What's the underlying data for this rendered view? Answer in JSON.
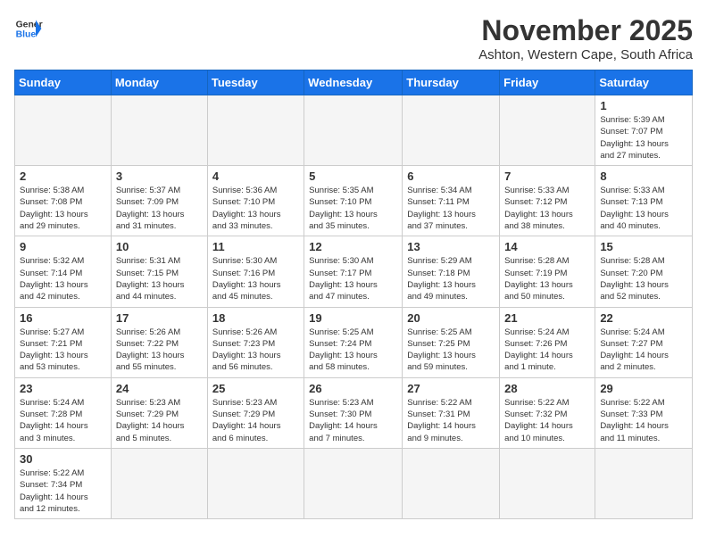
{
  "header": {
    "logo_general": "General",
    "logo_blue": "Blue",
    "month_year": "November 2025",
    "location": "Ashton, Western Cape, South Africa"
  },
  "weekdays": [
    "Sunday",
    "Monday",
    "Tuesday",
    "Wednesday",
    "Thursday",
    "Friday",
    "Saturday"
  ],
  "weeks": [
    [
      {
        "day": "",
        "info": ""
      },
      {
        "day": "",
        "info": ""
      },
      {
        "day": "",
        "info": ""
      },
      {
        "day": "",
        "info": ""
      },
      {
        "day": "",
        "info": ""
      },
      {
        "day": "",
        "info": ""
      },
      {
        "day": "1",
        "info": "Sunrise: 5:39 AM\nSunset: 7:07 PM\nDaylight: 13 hours\nand 27 minutes."
      }
    ],
    [
      {
        "day": "2",
        "info": "Sunrise: 5:38 AM\nSunset: 7:08 PM\nDaylight: 13 hours\nand 29 minutes."
      },
      {
        "day": "3",
        "info": "Sunrise: 5:37 AM\nSunset: 7:09 PM\nDaylight: 13 hours\nand 31 minutes."
      },
      {
        "day": "4",
        "info": "Sunrise: 5:36 AM\nSunset: 7:10 PM\nDaylight: 13 hours\nand 33 minutes."
      },
      {
        "day": "5",
        "info": "Sunrise: 5:35 AM\nSunset: 7:10 PM\nDaylight: 13 hours\nand 35 minutes."
      },
      {
        "day": "6",
        "info": "Sunrise: 5:34 AM\nSunset: 7:11 PM\nDaylight: 13 hours\nand 37 minutes."
      },
      {
        "day": "7",
        "info": "Sunrise: 5:33 AM\nSunset: 7:12 PM\nDaylight: 13 hours\nand 38 minutes."
      },
      {
        "day": "8",
        "info": "Sunrise: 5:33 AM\nSunset: 7:13 PM\nDaylight: 13 hours\nand 40 minutes."
      }
    ],
    [
      {
        "day": "9",
        "info": "Sunrise: 5:32 AM\nSunset: 7:14 PM\nDaylight: 13 hours\nand 42 minutes."
      },
      {
        "day": "10",
        "info": "Sunrise: 5:31 AM\nSunset: 7:15 PM\nDaylight: 13 hours\nand 44 minutes."
      },
      {
        "day": "11",
        "info": "Sunrise: 5:30 AM\nSunset: 7:16 PM\nDaylight: 13 hours\nand 45 minutes."
      },
      {
        "day": "12",
        "info": "Sunrise: 5:30 AM\nSunset: 7:17 PM\nDaylight: 13 hours\nand 47 minutes."
      },
      {
        "day": "13",
        "info": "Sunrise: 5:29 AM\nSunset: 7:18 PM\nDaylight: 13 hours\nand 49 minutes."
      },
      {
        "day": "14",
        "info": "Sunrise: 5:28 AM\nSunset: 7:19 PM\nDaylight: 13 hours\nand 50 minutes."
      },
      {
        "day": "15",
        "info": "Sunrise: 5:28 AM\nSunset: 7:20 PM\nDaylight: 13 hours\nand 52 minutes."
      }
    ],
    [
      {
        "day": "16",
        "info": "Sunrise: 5:27 AM\nSunset: 7:21 PM\nDaylight: 13 hours\nand 53 minutes."
      },
      {
        "day": "17",
        "info": "Sunrise: 5:26 AM\nSunset: 7:22 PM\nDaylight: 13 hours\nand 55 minutes."
      },
      {
        "day": "18",
        "info": "Sunrise: 5:26 AM\nSunset: 7:23 PM\nDaylight: 13 hours\nand 56 minutes."
      },
      {
        "day": "19",
        "info": "Sunrise: 5:25 AM\nSunset: 7:24 PM\nDaylight: 13 hours\nand 58 minutes."
      },
      {
        "day": "20",
        "info": "Sunrise: 5:25 AM\nSunset: 7:25 PM\nDaylight: 13 hours\nand 59 minutes."
      },
      {
        "day": "21",
        "info": "Sunrise: 5:24 AM\nSunset: 7:26 PM\nDaylight: 14 hours\nand 1 minute."
      },
      {
        "day": "22",
        "info": "Sunrise: 5:24 AM\nSunset: 7:27 PM\nDaylight: 14 hours\nand 2 minutes."
      }
    ],
    [
      {
        "day": "23",
        "info": "Sunrise: 5:24 AM\nSunset: 7:28 PM\nDaylight: 14 hours\nand 3 minutes."
      },
      {
        "day": "24",
        "info": "Sunrise: 5:23 AM\nSunset: 7:29 PM\nDaylight: 14 hours\nand 5 minutes."
      },
      {
        "day": "25",
        "info": "Sunrise: 5:23 AM\nSunset: 7:29 PM\nDaylight: 14 hours\nand 6 minutes."
      },
      {
        "day": "26",
        "info": "Sunrise: 5:23 AM\nSunset: 7:30 PM\nDaylight: 14 hours\nand 7 minutes."
      },
      {
        "day": "27",
        "info": "Sunrise: 5:22 AM\nSunset: 7:31 PM\nDaylight: 14 hours\nand 9 minutes."
      },
      {
        "day": "28",
        "info": "Sunrise: 5:22 AM\nSunset: 7:32 PM\nDaylight: 14 hours\nand 10 minutes."
      },
      {
        "day": "29",
        "info": "Sunrise: 5:22 AM\nSunset: 7:33 PM\nDaylight: 14 hours\nand 11 minutes."
      }
    ],
    [
      {
        "day": "30",
        "info": "Sunrise: 5:22 AM\nSunset: 7:34 PM\nDaylight: 14 hours\nand 12 minutes."
      },
      {
        "day": "",
        "info": ""
      },
      {
        "day": "",
        "info": ""
      },
      {
        "day": "",
        "info": ""
      },
      {
        "day": "",
        "info": ""
      },
      {
        "day": "",
        "info": ""
      },
      {
        "day": "",
        "info": ""
      }
    ]
  ]
}
